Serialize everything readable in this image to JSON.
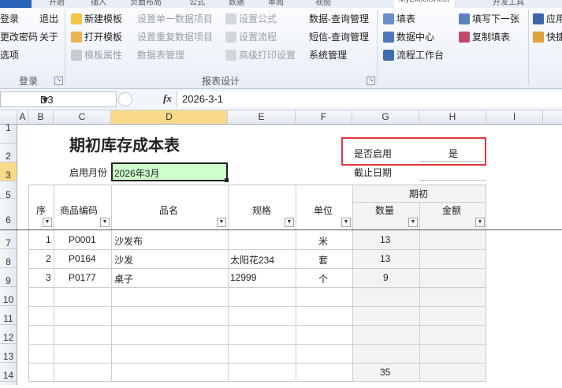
{
  "ribbon": {
    "tabs": [
      "文件",
      "开始",
      "插入",
      "页面布局",
      "公式",
      "数据",
      "审阅",
      "视图",
      "MyExcelSheet",
      "开发工具"
    ],
    "group_login": {
      "items": [
        "登录",
        "退出",
        "更改密码",
        "关于",
        "选项"
      ],
      "label": "登录"
    },
    "group_report": {
      "items": [
        "新建模板",
        "打开模板",
        "模板属性",
        "设置单一数据项目",
        "设置重复数据项目",
        "数据表管理",
        "设置公式",
        "设置流程",
        "高级打印设置",
        "数据-查询管理",
        "短信-查询管理",
        "系统管理"
      ],
      "label": "报表设计"
    },
    "group_fill": {
      "items": [
        "填表",
        "数据中心",
        "流程工作台",
        "填写下一张",
        "复制填表",
        "应用",
        "快捷"
      ]
    }
  },
  "formula_bar": {
    "name_box": "D3",
    "fx": "fx",
    "value": "2026-3-1"
  },
  "columns": [
    "A",
    "B",
    "C",
    "D",
    "E",
    "F",
    "G",
    "H",
    "I"
  ],
  "rows": [
    "1",
    "2",
    "3",
    "5",
    "6",
    "7",
    "8",
    "9",
    "10",
    "11",
    "12",
    "13",
    "14"
  ],
  "sheet": {
    "title": "期初库存成本表",
    "month_label": "启用月份",
    "month_value": "2026年3月",
    "enabled_label": "是否启用",
    "enabled_value": "是",
    "cutoff_label": "截止日期",
    "headers": {
      "seq": "序",
      "code": "商品编码",
      "name": "品名",
      "spec": "规格",
      "unit": "单位",
      "opening": "期初",
      "qty": "数量",
      "amount": "金额"
    },
    "rows": [
      {
        "seq": "1",
        "code": "P0001",
        "name": "沙发布",
        "spec": "",
        "unit": "米",
        "qty": "13"
      },
      {
        "seq": "2",
        "code": "P0164",
        "name": "沙发",
        "spec": "太阳花234",
        "unit": "套",
        "qty": "13"
      },
      {
        "seq": "3",
        "code": "P0177",
        "name": "桌子",
        "spec": "12999",
        "unit": "个",
        "qty": "9"
      }
    ],
    "total_qty": "35"
  },
  "colors": {
    "selected_cell_fill": "#ccffcc",
    "highlight_box": "#e0383e",
    "header_highlight": "#f9d98a"
  }
}
